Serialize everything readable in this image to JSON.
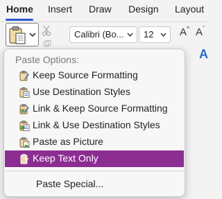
{
  "ribbon": {
    "tabs": [
      {
        "label": "Home",
        "active": true
      },
      {
        "label": "Insert",
        "active": false
      },
      {
        "label": "Draw",
        "active": false
      },
      {
        "label": "Design",
        "active": false
      },
      {
        "label": "Layout",
        "active": false
      }
    ],
    "font_name": "Calibri (Bo...",
    "font_size": "12",
    "grow_font_label": "A",
    "shrink_font_label": "A",
    "font_color_label": "A",
    "accent_color": "#2b57d1"
  },
  "paste_menu": {
    "heading": "Paste Options:",
    "items": [
      {
        "label": "Keep Source Formatting",
        "icon": "clipboard-brush-icon",
        "selected": false
      },
      {
        "label": "Use Destination Styles",
        "icon": "clipboard-doc-icon",
        "selected": false
      },
      {
        "label": "Link & Keep Source Formatting",
        "icon": "clipboard-link-brush-icon",
        "selected": false
      },
      {
        "label": "Link & Use Destination Styles",
        "icon": "clipboard-link-doc-icon",
        "selected": false
      },
      {
        "label": "Paste as Picture",
        "icon": "clipboard-picture-icon",
        "selected": false
      },
      {
        "label": "Keep Text Only",
        "icon": "clipboard-text-icon",
        "selected": true
      }
    ],
    "special_label": "Paste Special...",
    "highlight_color": "#8c2d92"
  }
}
